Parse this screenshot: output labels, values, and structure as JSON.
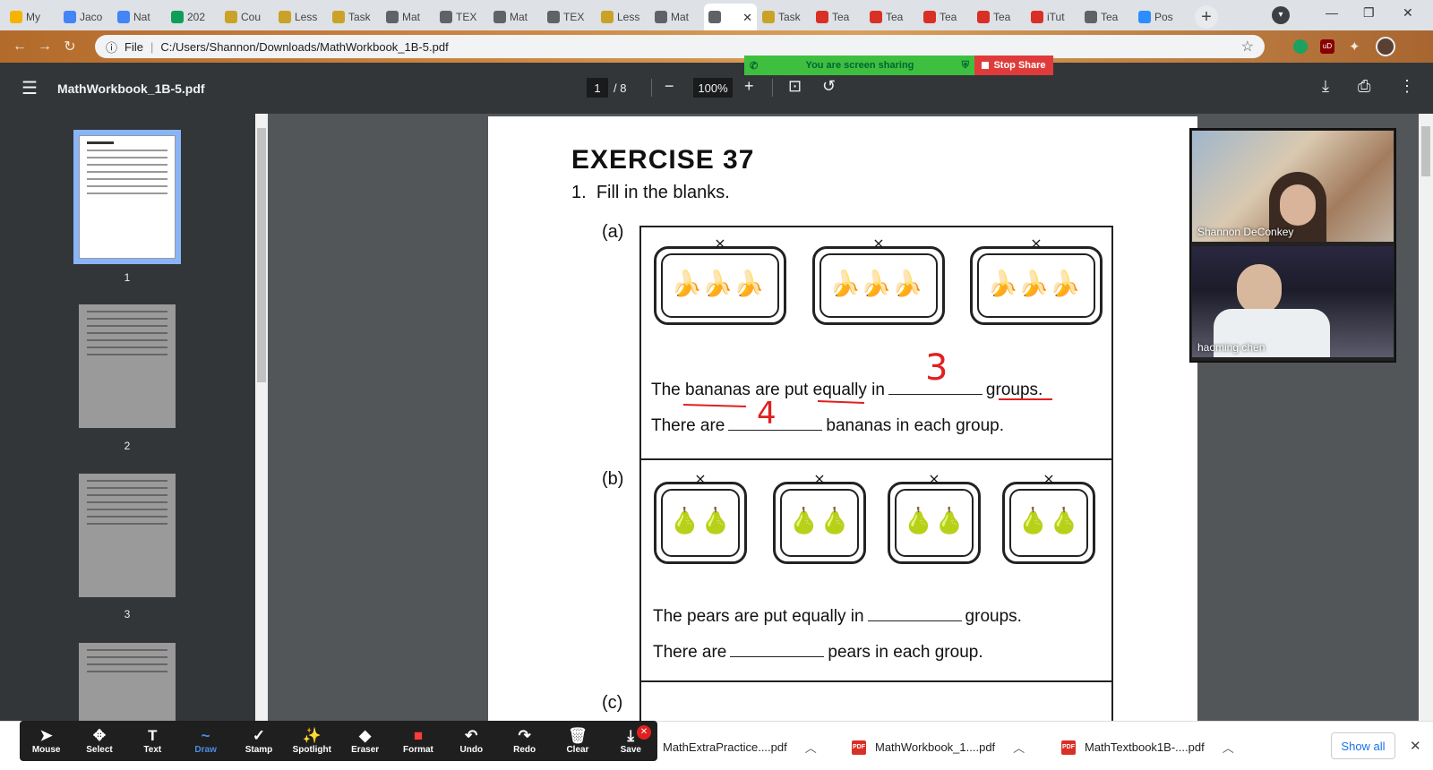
{
  "browser": {
    "tabs": [
      {
        "label": "My",
        "color": "#f4b400"
      },
      {
        "label": "Jaco",
        "color": "#4285f4"
      },
      {
        "label": "Nat",
        "color": "#4285f4"
      },
      {
        "label": "202",
        "color": "#0f9d58"
      },
      {
        "label": "Cou",
        "color": "#c9a227"
      },
      {
        "label": "Less",
        "color": "#c9a227"
      },
      {
        "label": "Task",
        "color": "#c9a227"
      },
      {
        "label": "Mat",
        "color": "#5f6368"
      },
      {
        "label": "TEX",
        "color": "#5f6368"
      },
      {
        "label": "Mat",
        "color": "#5f6368"
      },
      {
        "label": "TEX",
        "color": "#5f6368"
      },
      {
        "label": "Less",
        "color": "#c9a227"
      },
      {
        "label": "Mat",
        "color": "#5f6368"
      },
      {
        "label": "",
        "color": "#5f6368",
        "active": true,
        "close": "✕"
      },
      {
        "label": "Task",
        "color": "#c9a227"
      },
      {
        "label": "Tea",
        "color": "#d93025"
      },
      {
        "label": "Tea",
        "color": "#d93025"
      },
      {
        "label": "Tea",
        "color": "#d93025"
      },
      {
        "label": "Tea",
        "color": "#d93025"
      },
      {
        "label": "iTut",
        "color": "#d93025"
      },
      {
        "label": "Tea",
        "color": "#5f6368"
      },
      {
        "label": "Pos",
        "color": "#2d8cff"
      }
    ],
    "url_prefix": "File",
    "url": "C:/Users/Shannon/Downloads/MathWorkbook_1B-5.pdf"
  },
  "share": {
    "status": "You are screen sharing",
    "stop_label": "Stop Share"
  },
  "pdf": {
    "filename": "MathWorkbook_1B-5.pdf",
    "current_page": "1",
    "total_pages": "/ 8",
    "zoom": "100%",
    "thumbnails": [
      {
        "number": "1",
        "selected": true
      },
      {
        "number": "2"
      },
      {
        "number": "3"
      }
    ]
  },
  "worksheet": {
    "exercise": "EXERCISE 37",
    "question_num": "1.",
    "question": "Fill in the blanks.",
    "part_a_label": "(a)",
    "part_b_label": "(b)",
    "part_c_label": "(c)",
    "a_line1_start": "The bananas are put equally in",
    "a_line1_end": "groups.",
    "a_line2_start": "There are",
    "a_line2_end": "bananas in each group.",
    "b_line1_start": "The pears are put equally in",
    "b_line1_end": "groups.",
    "b_line2_start": "There are",
    "b_line2_end": "pears in each group.",
    "a_answer1": "3",
    "a_answer2": "4"
  },
  "videos": [
    {
      "name": "Shannon DeConkey"
    },
    {
      "name": "haoming chen"
    }
  ],
  "annotate_tools": [
    {
      "label": "Mouse",
      "icon": "mouse-pointer-icon",
      "glyph": "➤"
    },
    {
      "label": "Select",
      "icon": "select-move-icon",
      "glyph": "✥"
    },
    {
      "label": "Text",
      "icon": "text-icon",
      "glyph": "T"
    },
    {
      "label": "Draw",
      "icon": "draw-icon",
      "glyph": "~",
      "active": true
    },
    {
      "label": "Stamp",
      "icon": "stamp-check-icon",
      "glyph": "✓"
    },
    {
      "label": "Spotlight",
      "icon": "spotlight-icon",
      "glyph": "✨"
    },
    {
      "label": "Eraser",
      "icon": "eraser-icon",
      "glyph": "◆"
    },
    {
      "label": "Format",
      "icon": "format-color-icon",
      "glyph": "■"
    },
    {
      "label": "Undo",
      "icon": "undo-icon",
      "glyph": "↶"
    },
    {
      "label": "Redo",
      "icon": "redo-icon",
      "glyph": "↷"
    },
    {
      "label": "Clear",
      "icon": "trash-icon",
      "glyph": "🗑"
    },
    {
      "label": "Save",
      "icon": "save-download-icon",
      "glyph": "⤓"
    }
  ],
  "downloads": {
    "items": [
      {
        "name": "MathExtraPractice....pdf"
      },
      {
        "name": "MathWorkbook_1....pdf"
      },
      {
        "name": "MathTextbook1B-....pdf"
      }
    ],
    "show_all": "Show all",
    "pdf_badge": "PDF"
  }
}
